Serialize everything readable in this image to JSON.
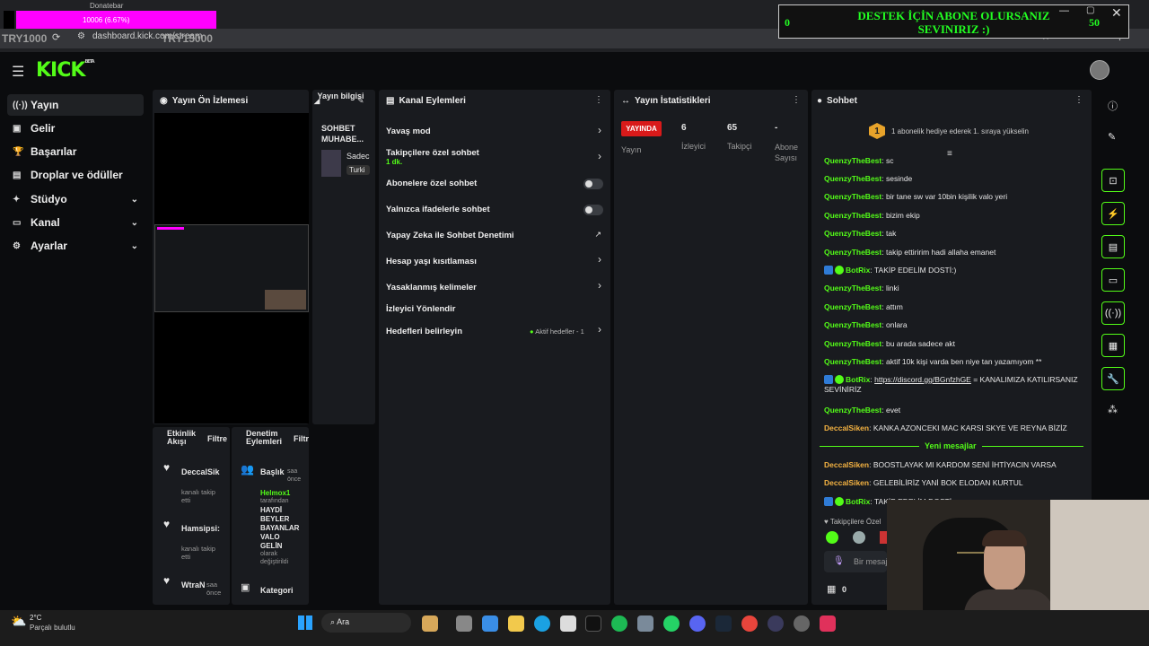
{
  "browser": {
    "tab_overlay_text": "10006 (6.67%)",
    "donate_label": "Donatebar",
    "url": "dashboard.kick.com/stream",
    "try_left": "TRY1000",
    "try_right": "TRY15000"
  },
  "overlay_banner": {
    "left_value": "0",
    "text": "DESTEK İÇİN ABONE OLURSANIZ SEVINIRIZ :)",
    "right_value": "50"
  },
  "app": {
    "logo": "KICK",
    "logo_beta": "BETA"
  },
  "sidebar": {
    "items": [
      {
        "label": "Yayın",
        "icon": "broadcast-icon"
      },
      {
        "label": "Gelir",
        "icon": "revenue-icon"
      },
      {
        "label": "Başarılar",
        "icon": "trophy-icon"
      },
      {
        "label": "Droplar ve ödüller",
        "icon": "gift-icon"
      },
      {
        "label": "Stüdyo",
        "icon": "studio-icon"
      },
      {
        "label": "Kanal",
        "icon": "channel-icon"
      },
      {
        "label": "Ayarlar",
        "icon": "gear-icon"
      }
    ]
  },
  "preview_panel": {
    "title": "Yayın Ön İzlemesi"
  },
  "stream_info": {
    "title": "Yayın bilgisi",
    "stream_title": "SOHBET MUHABE...",
    "name_clip": "Sadec",
    "lang_clip": "Turki"
  },
  "activity": {
    "title": "Etkinlik Akışı",
    "filter": "Filtre",
    "items": [
      {
        "user": "DeccalSik",
        "desc": "kanalı takip etti"
      },
      {
        "user": "Hamsipsi:",
        "desc": "kanalı takip etti"
      },
      {
        "user": "WtraN",
        "desc": "saa önce"
      }
    ]
  },
  "moderation": {
    "title": "Denetim Eylemleri",
    "filter": "Filtr",
    "item1_title": "Başlık",
    "item1_time": "saa önce",
    "item1_user": "Helmox1",
    "item1_lines": [
      "tarafından",
      "HAYDİ",
      "BEYLER",
      "BAYANLAR",
      "VALO",
      "GELİN",
      "olarak",
      "değiştirildi"
    ],
    "item2_title": "Kategori"
  },
  "channel_actions": {
    "title": "Kanal Eylemleri",
    "slow_mode": "Yavaş mod",
    "followers_chat": "Takipçilere özel sohbet",
    "followers_sub": "1 dk.",
    "subs_chat": "Abonelere özel sohbet",
    "emote_chat": "Yalnızca ifadelerle sohbet",
    "ai_mod": "Yapay Zeka ile Sohbet Denetimi",
    "age_limit": "Hesap yaşı kısıtlaması",
    "banned_words": "Yasaklanmış kelimeler",
    "viewer_redirect": "İzleyici Yönlendir",
    "goals": "Hedefleri belirleyin",
    "goals_status": "Aktif hedefler - 1"
  },
  "stats": {
    "title": "Yayın İstatistikleri",
    "live_badge": "YAYINDA",
    "live_label": "Yayın",
    "viewers_value": "6",
    "viewers_label": "İzleyici",
    "followers_value": "65",
    "followers_label": "Takipçi",
    "subs_value": "-",
    "subs_label": "Abone Sayısı"
  },
  "chat": {
    "title": "Sohbet",
    "gift_rank": "1",
    "gift_text": "1 abonelik hediye ederek 1. sıraya yükselin",
    "messages": [
      {
        "user": "QuenzyTheBest",
        "text": "sc"
      },
      {
        "user": "QuenzyTheBest",
        "text": "sesinde"
      },
      {
        "user": "QuenzyTheBest",
        "text": "bir tane sw var 10bin kişilik valo yeri"
      },
      {
        "user": "QuenzyTheBest",
        "text": "bizim ekip"
      },
      {
        "user": "QuenzyTheBest",
        "text": "tak"
      },
      {
        "user": "QuenzyTheBest",
        "text": "takip ettiririm hadi allaha emanet"
      },
      {
        "user": "BotRix",
        "text": "TAKİP EDELİM DOSTİ:)"
      },
      {
        "user": "QuenzyTheBest",
        "text": "linki"
      },
      {
        "user": "QuenzyTheBest",
        "text": "attım"
      },
      {
        "user": "QuenzyTheBest",
        "text": "onlara"
      },
      {
        "user": "QuenzyTheBest",
        "text": "bu arada sadece akt"
      },
      {
        "user": "QuenzyTheBest",
        "text": "aktif 10k kişi varda ben niye tan yazamıyom **"
      },
      {
        "user": "BotRix",
        "link": "https://discord.gg/BGnfzhGE",
        "text": "= KANALIMIZA KATILIRSANIZ SEVİNİRİZ"
      },
      {
        "user": "QuenzyTheBest",
        "text": "evet"
      },
      {
        "user": "DeccalSiken",
        "text": "KANKA AZONCEKI MAC KARSI SKYE VE REYNA BİZİZ"
      }
    ],
    "new_messages": "Yeni mesajlar",
    "new": [
      {
        "user": "DeccalSiken",
        "text": "BOOSTLAYAK MI KARDOM SENİ İHTİYACIN VARSA"
      },
      {
        "user": "DeccalSiken",
        "text": "GELEBİLİRİZ YANİ BOK ELODAN KURTUL"
      },
      {
        "user": "BotRix",
        "text": "TAKİP EDELİM DOSTİ"
      }
    ],
    "followers_only": "Takipçilere Özel",
    "input_placeholder": "Bir mesaj",
    "count": "0"
  },
  "taskbar": {
    "temp": "2°C",
    "weather": "Parçalı bulutlu",
    "search": "Ara"
  }
}
